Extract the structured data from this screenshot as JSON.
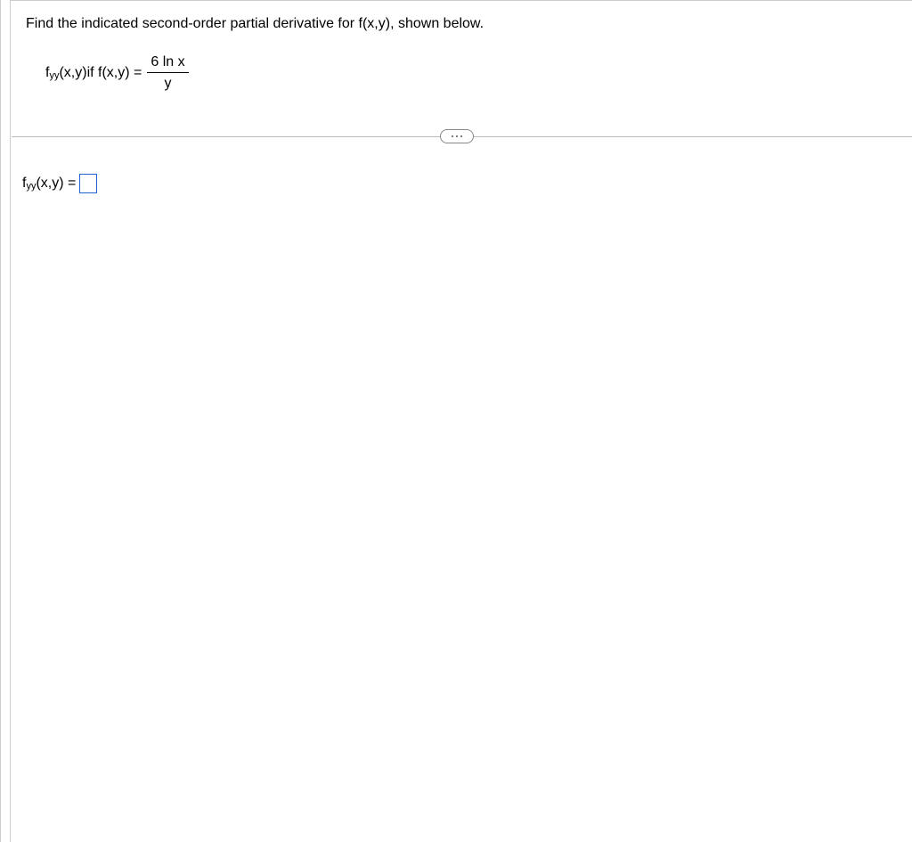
{
  "question": {
    "prompt": "Find the indicated second-order partial derivative for f(x,y), shown below.",
    "lhs_f": "f",
    "lhs_sub": "yy",
    "lhs_args": "(x,y)",
    "if_text": " if f(x,y) = ",
    "fraction_num": "6 ln x",
    "fraction_den": "y"
  },
  "answer": {
    "lhs_f": "f",
    "lhs_sub": "yy",
    "lhs_args": "(x,y) = ",
    "input_value": ""
  }
}
